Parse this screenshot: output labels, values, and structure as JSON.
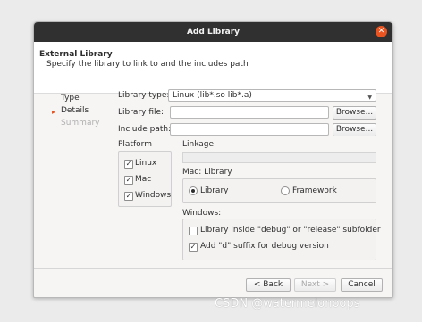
{
  "dialog": {
    "title": "Add Library",
    "header_title": "External Library",
    "header_subtitle": "Specify the library to link to and the includes path"
  },
  "steps": [
    "Type",
    "Details",
    "Summary"
  ],
  "form": {
    "library_type_label": "Library type:",
    "library_type_value": "Linux (lib*.so lib*.a)",
    "library_file_label": "Library file:",
    "include_path_label": "Include path:",
    "browse_label": "Browse..."
  },
  "platform": {
    "label": "Platform",
    "items": [
      {
        "label": "Linux",
        "checked": true
      },
      {
        "label": "Mac",
        "checked": true
      },
      {
        "label": "Windows",
        "checked": true
      }
    ]
  },
  "linkage": {
    "label": "Linkage:"
  },
  "mac": {
    "label": "Mac: Library",
    "options": [
      "Library",
      "Framework"
    ],
    "selected": "Library"
  },
  "windows": {
    "label": "Windows:",
    "opt_debug_folder": "Library inside \"debug\" or \"release\" subfolder",
    "opt_d_suffix": "Add \"d\" suffix for debug version"
  },
  "buttons": {
    "back": "< Back",
    "next": "Next >",
    "cancel": "Cancel"
  },
  "watermark": "CSDN @watermelonoops",
  "colors": {
    "accent": "#e95420",
    "titlebar": "#303030"
  }
}
